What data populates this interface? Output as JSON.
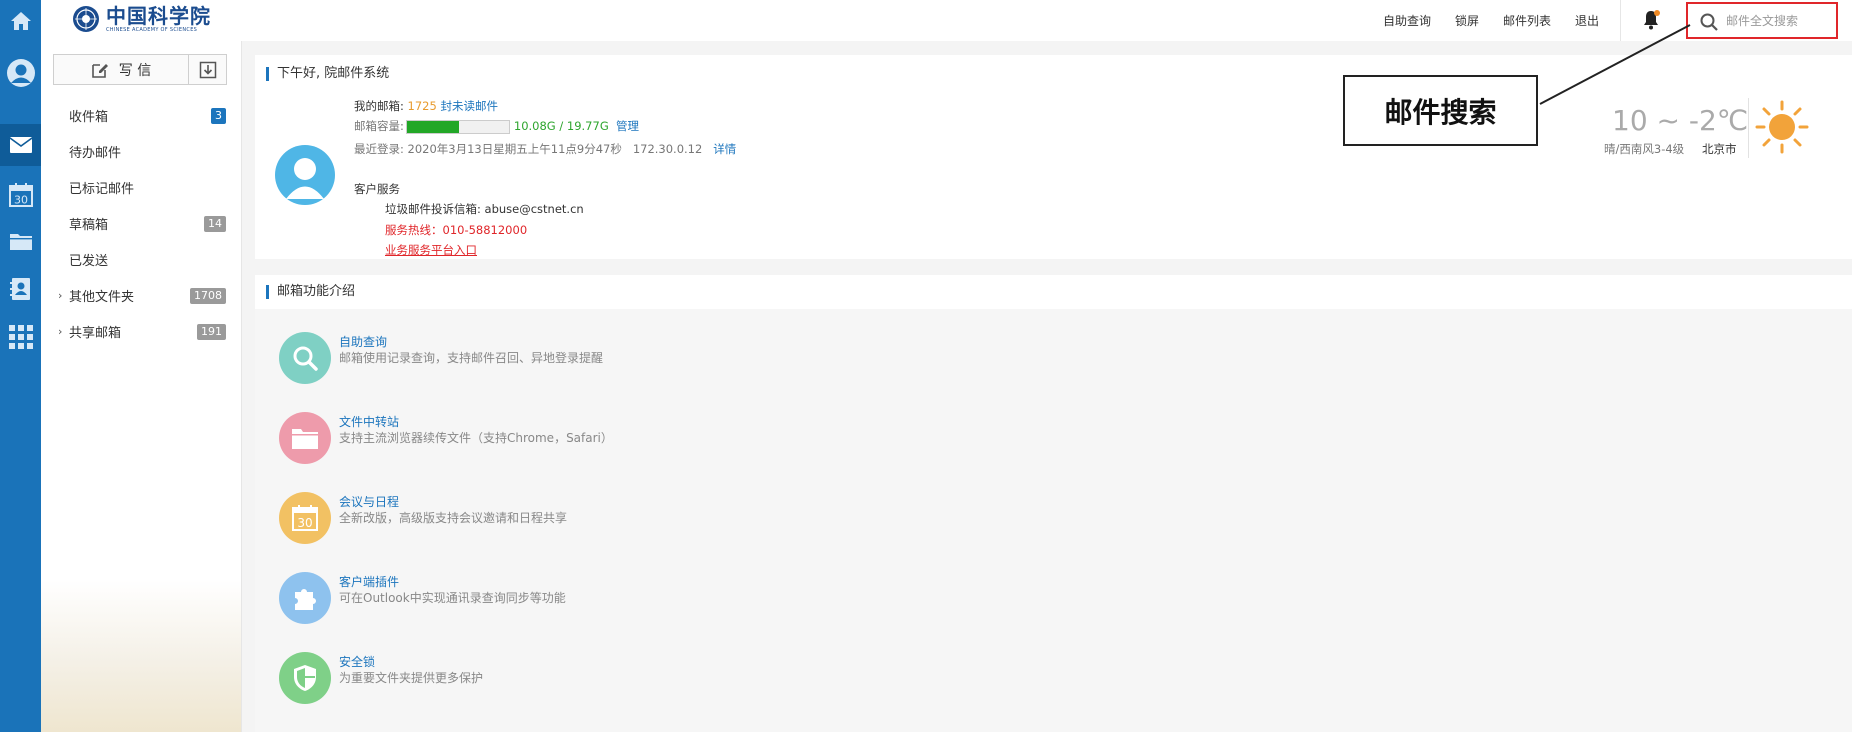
{
  "header": {
    "logo_cn": "中国科学院",
    "logo_en": "CHINESE ACADEMY OF SCIENCES",
    "links": [
      "自助查询",
      "锁屏",
      "邮件列表",
      "退出"
    ],
    "search_placeholder": "邮件全文搜索"
  },
  "rail": {
    "icons": [
      "home-icon",
      "avatar-icon",
      "mail-icon",
      "calendar-icon",
      "folder-icon",
      "contacts-icon",
      "apps-icon"
    ],
    "calendar_day": "30",
    "active": "mail-icon"
  },
  "sidebar": {
    "write_label": "写 信",
    "folders": [
      {
        "label": "收件箱",
        "count": "3",
        "badge": "blue",
        "expandable": false
      },
      {
        "label": "待办邮件",
        "count": "",
        "badge": "",
        "expandable": false
      },
      {
        "label": "已标记邮件",
        "count": "",
        "badge": "",
        "expandable": false
      },
      {
        "label": "草稿箱",
        "count": "14",
        "badge": "gray",
        "expandable": false
      },
      {
        "label": "已发送",
        "count": "",
        "badge": "",
        "expandable": false
      },
      {
        "label": "其他文件夹",
        "count": "1708",
        "badge": "gray",
        "expandable": true
      },
      {
        "label": "共享邮箱",
        "count": "191",
        "badge": "gray",
        "expandable": true
      }
    ]
  },
  "greeting": {
    "title": "下午好, 院邮件系统",
    "mailbox_label": "我的邮箱:",
    "unread_count": "1725",
    "unread_label": "封未读邮件",
    "capacity_label": "邮箱容量:",
    "capacity_used_fraction": 0.51,
    "capacity_text": "10.08G / 19.77G",
    "manage_link": "管理",
    "last_login_label": "最近登录:",
    "last_login_time": "2020年3月13日星期五上午11点9分47秒",
    "last_login_ip": "172.30.0.12",
    "detail_link": "详情",
    "service_title": "客户服务",
    "spam_label": "垃圾邮件投诉信箱:",
    "spam_email": "abuse@cstnet.cn",
    "hotline": "服务热线：010-58812000",
    "portal_link": "业务服务平台入口"
  },
  "weather": {
    "temp": "10 ~ -2℃",
    "desc": "晴/西南风3-4级",
    "city": "北京市"
  },
  "features": {
    "title": "邮箱功能介绍",
    "items": [
      {
        "title": "自助查询",
        "desc": "邮箱使用记录查询，支持邮件召回、异地登录提醒",
        "icon": "search-icon",
        "color": "#7fd0c4"
      },
      {
        "title": "文件中转站",
        "desc": "支持主流浏览器续传文件（支持Chrome，Safari）",
        "icon": "folder-icon",
        "color": "#ee9bab"
      },
      {
        "title": "会议与日程",
        "desc": "全新改版，高级版支持会议邀请和日程共享",
        "icon": "calendar-icon",
        "color": "#f2c163"
      },
      {
        "title": "客户端插件",
        "desc": "可在Outlook中实现通讯录查询同步等功能",
        "icon": "plugin-icon",
        "color": "#8ec2ee"
      },
      {
        "title": "安全锁",
        "desc": "为重要文件夹提供更多保护",
        "icon": "shield-icon",
        "color": "#7fd088"
      }
    ],
    "calendar_day": "30"
  },
  "annotation": {
    "label": "邮件搜索"
  }
}
